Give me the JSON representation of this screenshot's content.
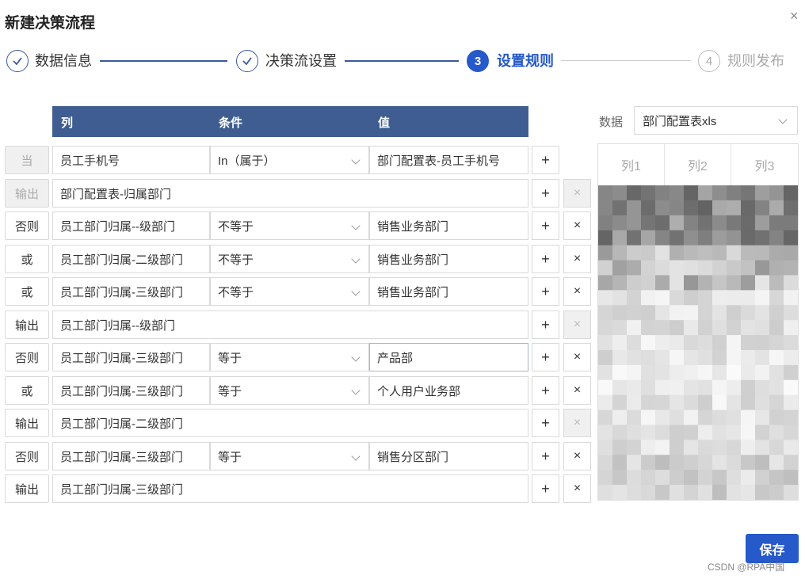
{
  "dialog": {
    "title": "新建决策流程",
    "close_icon": "×"
  },
  "steps": [
    {
      "label": "数据信息",
      "state": "done",
      "mark": ""
    },
    {
      "label": "决策流设置",
      "state": "done",
      "mark": ""
    },
    {
      "label": "设置规则",
      "state": "active",
      "mark": "3"
    },
    {
      "label": "规则发布",
      "state": "todo",
      "mark": "4"
    }
  ],
  "table": {
    "headers": {
      "column": "列",
      "condition": "条件",
      "value": "值"
    },
    "rows": [
      {
        "tag": "当",
        "tag_disabled": true,
        "type": "cond",
        "column": "员工手机号",
        "condition": "In（属于）",
        "value": "部门配置表-员工手机号",
        "delete_disabled": null
      },
      {
        "tag": "输出",
        "tag_disabled": true,
        "type": "output",
        "output": "部门配置表-归属部门",
        "delete_disabled": true
      },
      {
        "tag": "否则",
        "tag_disabled": false,
        "type": "cond",
        "column": "员工部门归属--级部门",
        "condition": "不等于",
        "value": "销售业务部门",
        "delete_disabled": false
      },
      {
        "tag": "或",
        "tag_disabled": false,
        "type": "cond",
        "column": "员工部门归属-二级部门",
        "condition": "不等于",
        "value": "销售业务部门",
        "delete_disabled": false
      },
      {
        "tag": "或",
        "tag_disabled": false,
        "type": "cond",
        "column": "员工部门归属-三级部门",
        "condition": "不等于",
        "value": "销售业务部门",
        "delete_disabled": false
      },
      {
        "tag": "输出",
        "tag_disabled": false,
        "type": "output",
        "output": "员工部门归属--级部门",
        "delete_disabled": true
      },
      {
        "tag": "否则",
        "tag_disabled": false,
        "type": "cond",
        "column": "员工部门归属-三级部门",
        "condition": "等于",
        "value": "产品部",
        "delete_disabled": false,
        "focus": true
      },
      {
        "tag": "或",
        "tag_disabled": false,
        "type": "cond",
        "column": "员工部门归属-三级部门",
        "condition": "等于",
        "value": "个人用户业务部",
        "delete_disabled": false
      },
      {
        "tag": "输出",
        "tag_disabled": false,
        "type": "output",
        "output": "员工部门归属-二级部门",
        "delete_disabled": true
      },
      {
        "tag": "否则",
        "tag_disabled": false,
        "type": "cond",
        "column": "员工部门归属-三级部门",
        "condition": "等于",
        "value": "销售分区部门",
        "delete_disabled": false
      },
      {
        "tag": "输出",
        "tag_disabled": false,
        "type": "output",
        "output": "员工部门归属-三级部门",
        "delete_disabled": false
      }
    ],
    "add_icon": "+",
    "delete_icon": "×"
  },
  "data_panel": {
    "label": "数据",
    "selected_source": "部门配置表xls",
    "columns": [
      "列1",
      "列2",
      "列3"
    ]
  },
  "footer": {
    "save_label": "保存",
    "watermark": "CSDN @RPA中国"
  },
  "colors": {
    "primary": "#2659c9",
    "header_bg": "#3f5d91",
    "step_done": "#3a5a9b"
  }
}
